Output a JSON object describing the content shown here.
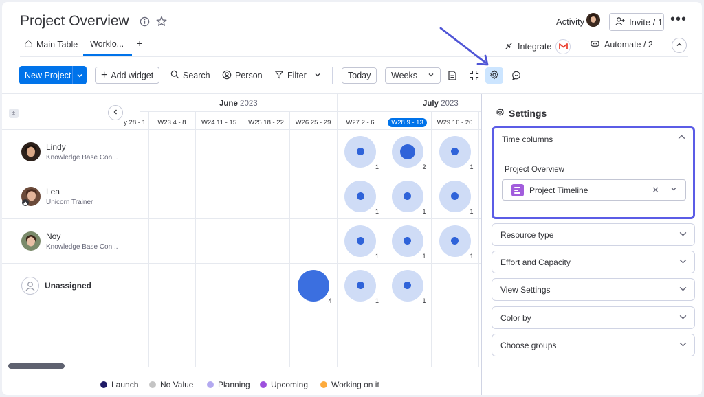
{
  "header": {
    "title": "Project Overview",
    "activity_label": "Activity",
    "invite_label": "Invite / 1",
    "more_label": "•••"
  },
  "tabs": [
    {
      "label": "Main Table"
    },
    {
      "label": "Worklo..."
    },
    {
      "label": "+"
    }
  ],
  "header_right": {
    "integrate_label": "Integrate",
    "automate_label": "Automate / 2"
  },
  "toolbar": {
    "new_project_label": "New Project",
    "add_widget_label": "Add widget",
    "search_label": "Search",
    "person_label": "Person",
    "filter_label": "Filter",
    "today_label": "Today",
    "weeks_label": "Weeks"
  },
  "timeline": {
    "months": [
      {
        "name": "June",
        "year": "2023"
      },
      {
        "name": "July",
        "year": "2023"
      }
    ],
    "weeks": [
      "y 28 - 1",
      "W23 4 - 8",
      "W24 11 - 15",
      "W25 18 - 22",
      "W26 25 - 29",
      "W27 2 - 6",
      "W28 9 - 13",
      "W29 16 - 20"
    ],
    "current_week": "W28 9 - 13"
  },
  "people": [
    {
      "name": "Lindy",
      "role": "Knowledge Base Con..."
    },
    {
      "name": "Lea",
      "role": "Unicorn Trainer"
    },
    {
      "name": "Noy",
      "role": "Knowledge Base Con..."
    },
    {
      "name": "Unassigned",
      "role": ""
    }
  ],
  "workload": [
    {
      "row": 0,
      "week": "W27 2 - 6",
      "count": "1",
      "style": "light"
    },
    {
      "row": 0,
      "week": "W28 9 - 13",
      "count": "2",
      "style": "medium"
    },
    {
      "row": 0,
      "week": "W29 16 - 20",
      "count": "1",
      "style": "light"
    },
    {
      "row": 1,
      "week": "W27 2 - 6",
      "count": "1",
      "style": "light"
    },
    {
      "row": 1,
      "week": "W28 9 - 13",
      "count": "1",
      "style": "light"
    },
    {
      "row": 1,
      "week": "W29 16 - 20",
      "count": "1",
      "style": "light"
    },
    {
      "row": 2,
      "week": "W27 2 - 6",
      "count": "1",
      "style": "light"
    },
    {
      "row": 2,
      "week": "W28 9 - 13",
      "count": "1",
      "style": "light"
    },
    {
      "row": 2,
      "week": "W29 16 - 20",
      "count": "1",
      "style": "light"
    },
    {
      "row": 3,
      "week": "W26 25 - 29",
      "count": "4",
      "style": "full"
    },
    {
      "row": 3,
      "week": "W27 2 - 6",
      "count": "1",
      "style": "light"
    },
    {
      "row": 3,
      "week": "W28 9 - 13",
      "count": "1",
      "style": "light"
    }
  ],
  "legend": [
    {
      "label": "Launch",
      "color": "#1f1a66"
    },
    {
      "label": "No Value",
      "color": "#c4c4c4"
    },
    {
      "label": "Planning",
      "color": "#b3a9f0"
    },
    {
      "label": "Upcoming",
      "color": "#9d50dd"
    },
    {
      "label": "Working on it",
      "color": "#fdab3d"
    }
  ],
  "settings": {
    "title": "Settings",
    "time_columns_label": "Time columns",
    "project_overview_label": "Project Overview",
    "selected_column": "Project Timeline",
    "sections": [
      "Resource type",
      "Effort and Capacity",
      "View Settings",
      "Color by",
      "Choose groups"
    ]
  },
  "colors": {
    "primary": "#0073ea",
    "highlight_border": "#5b5ce6",
    "bubble_light": "#cfdcf6",
    "bubble_dot": "#2f63d9"
  }
}
